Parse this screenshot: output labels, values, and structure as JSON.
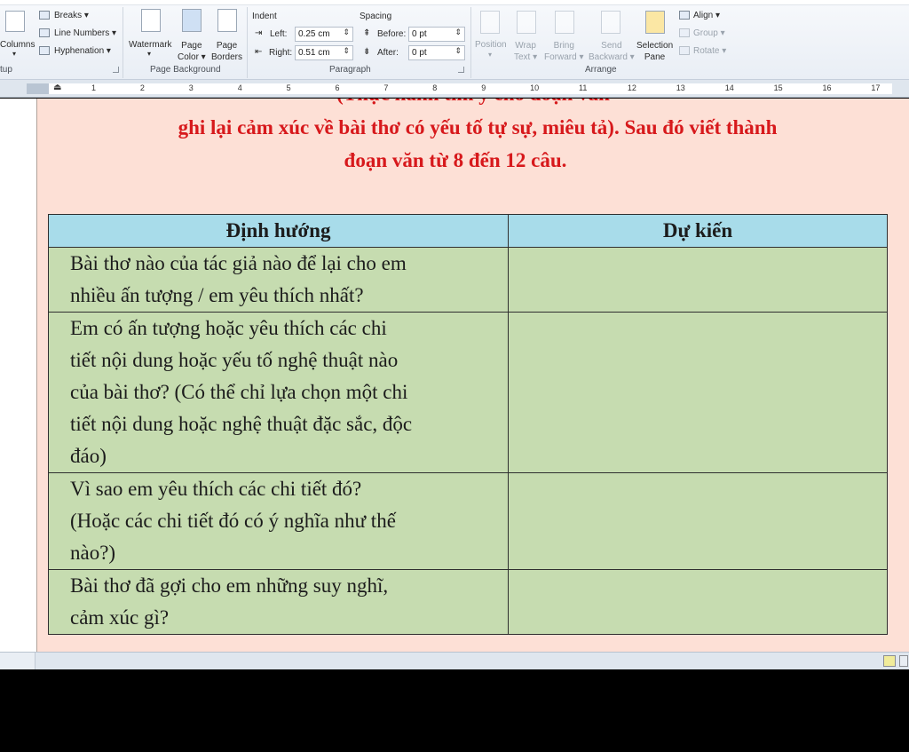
{
  "ribbon": {
    "columns_label": "Columns",
    "breaks_label": "Breaks ▾",
    "line_numbers_label": "Line Numbers ▾",
    "hyphenation_label": "Hyphenation ▾",
    "page_setup_group": "tup",
    "watermark_label": "Watermark",
    "page_color_label": "Page\nColor ▾",
    "page_borders_label": "Page\nBorders",
    "page_background_group": "Page Background",
    "indent_label": "Indent",
    "indent_left_label": "Left:",
    "indent_left_value": "0.25 cm",
    "indent_right_label": "Right:",
    "indent_right_value": "0.51 cm",
    "spacing_label": "Spacing",
    "spacing_before_label": "Before:",
    "spacing_before_value": "0 pt",
    "spacing_after_label": "After:",
    "spacing_after_value": "0 pt",
    "paragraph_group": "Paragraph",
    "position_label": "Position",
    "wrap_text_label": "Wrap\nText ▾",
    "bring_forward_label": "Bring\nForward ▾",
    "send_backward_label": "Send\nBackward ▾",
    "selection_pane_label": "Selection\nPane",
    "align_label": "Align ▾",
    "group_label": "Group ▾",
    "rotate_label": "Rotate ▾",
    "arrange_group": "Arrange"
  },
  "ruler": {
    "ticks": [
      "1",
      "2",
      "3",
      "4",
      "5",
      "6",
      "7",
      "8",
      "9",
      "10",
      "11",
      "12",
      "13",
      "14",
      "15",
      "16",
      "17"
    ]
  },
  "document": {
    "heading_line0": "(Thực hành tìm ý cho đoạn văn",
    "heading_line1": "ghi lại cảm xúc về bài thơ có yếu tố tự sự, miêu tả). Sau đó viết thành",
    "heading_line2": "đoạn văn từ 8 đến 12 câu.",
    "table": {
      "headers": [
        "Định hướng",
        "Dự kiến"
      ],
      "rows": [
        "Bài thơ nào của tác giả nào để lại cho em\nnhiều ấn tượng / em yêu thích nhất?",
        "Em có ấn tượng hoặc yêu thích các chi\ntiết nội dung hoặc yếu tố nghệ thuật nào\ncủa bài thơ? (Có thể chỉ lựa chọn một chi\ntiết nội dung hoặc nghệ thuật đặc sắc, độc\nđáo)",
        "Vì sao em yêu thích các chi tiết đó?\n(Hoặc các chi tiết đó có ý nghĩa như thế\nnào?)",
        "Bài thơ đã gợi cho em những suy nghĩ,\ncảm xúc gì?"
      ]
    }
  },
  "colors": {
    "heading": "#d7191c",
    "page_background": "#fde0d6",
    "table_header": "#a8dcea",
    "table_body": "#c6dcb0"
  }
}
